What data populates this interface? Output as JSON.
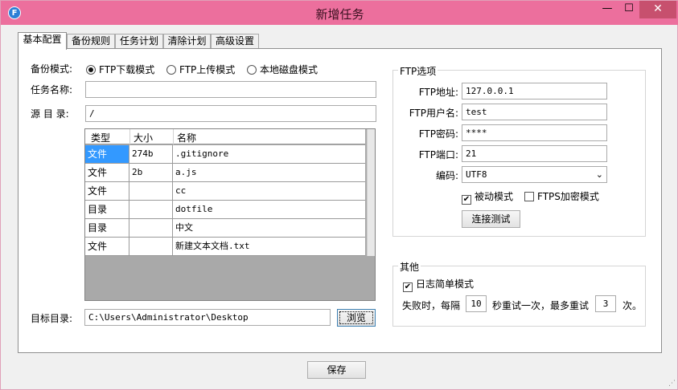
{
  "window": {
    "title": "新增任务",
    "icon_glyph": "F",
    "min_glyph": "—",
    "max_glyph": "☐",
    "close_glyph": "✕"
  },
  "tabs": [
    {
      "label": "基本配置",
      "active": true
    },
    {
      "label": "备份规则",
      "active": false
    },
    {
      "label": "任务计划",
      "active": false
    },
    {
      "label": "清除计划",
      "active": false
    },
    {
      "label": "高级设置",
      "active": false
    }
  ],
  "basic": {
    "mode_label": "备份模式:",
    "modes": [
      {
        "label": "FTP下载模式",
        "selected": true
      },
      {
        "label": "FTP上传模式",
        "selected": false
      },
      {
        "label": "本地磁盘模式",
        "selected": false
      }
    ],
    "task_name_label": "任务名称:",
    "task_name_value": "",
    "source_label": "源 目 录:",
    "source_value": "/",
    "target_label": "目标目录:",
    "target_value": "C:\\Users\\Administrator\\Desktop",
    "browse_label": "浏览"
  },
  "file_grid": {
    "columns": [
      "类型",
      "大小",
      "名称"
    ],
    "rows": [
      {
        "type": "文件",
        "size": "274b",
        "name": ".gitignore",
        "selected": true
      },
      {
        "type": "文件",
        "size": "2b",
        "name": "a.js",
        "selected": false
      },
      {
        "type": "文件",
        "size": "",
        "name": "cc",
        "selected": false
      },
      {
        "type": "目录",
        "size": "",
        "name": "dotfile",
        "selected": false
      },
      {
        "type": "目录",
        "size": "",
        "name": "中文",
        "selected": false
      },
      {
        "type": "文件",
        "size": "",
        "name": "新建文本文档.txt",
        "selected": false
      }
    ]
  },
  "ftp": {
    "group_title": "FTP选项",
    "address_label": "FTP地址:",
    "address_value": "127.0.0.1",
    "user_label": "FTP用户名:",
    "user_value": "test",
    "password_label": "FTP密码:",
    "password_value": "****",
    "port_label": "FTP端口:",
    "port_value": "21",
    "encoding_label": "编码:",
    "encoding_value": "UTF8",
    "passive_label": "被动模式",
    "passive_checked": true,
    "ftps_label": "FTPS加密模式",
    "ftps_checked": false,
    "test_label": "连接测试"
  },
  "other": {
    "group_title": "其他",
    "simple_log_label": "日志简单模式",
    "simple_log_checked": true,
    "retry_prefix": "失败时，每隔",
    "retry_interval": "10",
    "retry_middle": "秒重试一次，最多重试",
    "retry_count": "3",
    "retry_suffix": "次。"
  },
  "footer": {
    "save_label": "保存"
  }
}
